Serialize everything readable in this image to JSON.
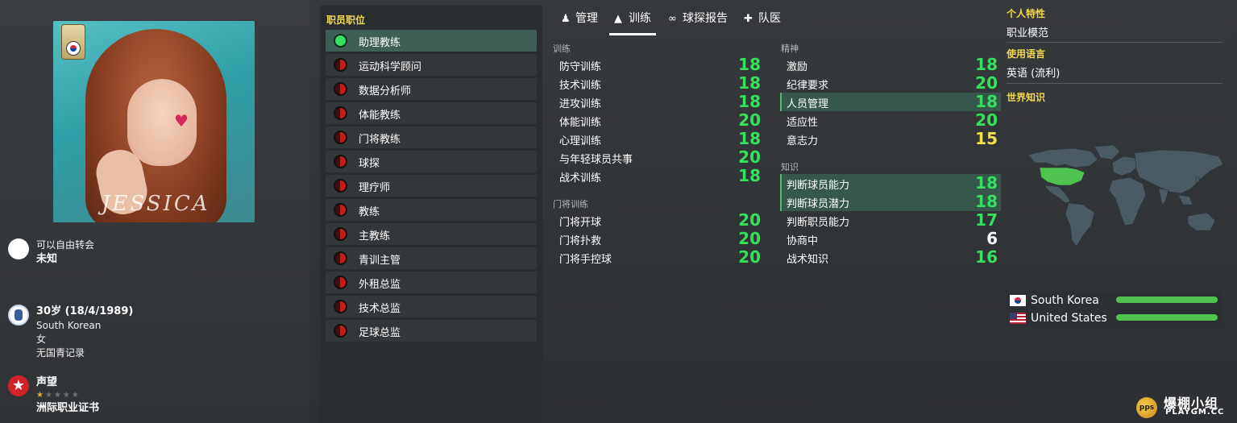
{
  "profile": {
    "transfer_status": "可以自由转会",
    "transfer_value": "未知",
    "age_line": "30岁 (18/4/1989)",
    "nationality": "South Korean",
    "gender": "女",
    "youth_record": "无国青记录",
    "reputation_label": "声望",
    "reputation_stars": 0.5,
    "license": "洲际职业证书",
    "portrait_signature": "JESSICA"
  },
  "roles": {
    "title": "职员职位",
    "items": [
      {
        "label": "助理教练",
        "selected": true
      },
      {
        "label": "运动科学顾问",
        "selected": false
      },
      {
        "label": "数据分析师",
        "selected": false
      },
      {
        "label": "体能教练",
        "selected": false
      },
      {
        "label": "门将教练",
        "selected": false
      },
      {
        "label": "球探",
        "selected": false
      },
      {
        "label": "理疗师",
        "selected": false
      },
      {
        "label": "教练",
        "selected": false
      },
      {
        "label": "主教练",
        "selected": false
      },
      {
        "label": "青训主管",
        "selected": false
      },
      {
        "label": "外租总监",
        "selected": false
      },
      {
        "label": "技术总监",
        "selected": false
      },
      {
        "label": "足球总监",
        "selected": false
      }
    ]
  },
  "tabs": [
    {
      "label": "管理",
      "icon": "manager-icon"
    },
    {
      "label": "训练",
      "icon": "cone-icon",
      "active": true
    },
    {
      "label": "球探报告",
      "icon": "binoculars-icon"
    },
    {
      "label": "队医",
      "icon": "medical-kit-icon"
    }
  ],
  "training": {
    "title": "训练",
    "rows": [
      {
        "name": "防守训练",
        "value": "18"
      },
      {
        "name": "技术训练",
        "value": "18"
      },
      {
        "name": "进攻训练",
        "value": "18"
      },
      {
        "name": "体能训练",
        "value": "20"
      },
      {
        "name": "心理训练",
        "value": "18"
      },
      {
        "name": "与年轻球员共事",
        "value": "20"
      },
      {
        "name": "战术训练",
        "value": "18"
      }
    ]
  },
  "goalkeeping": {
    "title": "门将训练",
    "rows": [
      {
        "name": "门将开球",
        "value": "20"
      },
      {
        "name": "门将扑救",
        "value": "20"
      },
      {
        "name": "门将手控球",
        "value": "20"
      }
    ]
  },
  "mental": {
    "title": "精神",
    "rows": [
      {
        "name": "激励",
        "value": "18"
      },
      {
        "name": "纪律要求",
        "value": "20"
      },
      {
        "name": "人员管理",
        "value": "18",
        "highlight": true
      },
      {
        "name": "适应性",
        "value": "20"
      },
      {
        "name": "意志力",
        "value": "15"
      }
    ]
  },
  "knowledge": {
    "title": "知识",
    "rows": [
      {
        "name": "判断球员能力",
        "value": "18",
        "highlight": true
      },
      {
        "name": "判断球员潜力",
        "value": "18",
        "highlight": true
      },
      {
        "name": "判断职员能力",
        "value": "17"
      },
      {
        "name": "协商中",
        "value": "6"
      },
      {
        "name": "战术知识",
        "value": "16"
      }
    ]
  },
  "right_panel": {
    "traits_title": "个人特性",
    "traits_value": "职业模范",
    "languages_title": "使用语言",
    "languages_value": "英语 (流利)",
    "world_title": "世界知识",
    "world_highlight_country": "United States",
    "countries": [
      {
        "name": "South Korea",
        "flag": "south-korea-flag-icon",
        "level": 1.0
      },
      {
        "name": "United States",
        "flag": "usa-flag-icon",
        "level": 1.0
      }
    ]
  },
  "colors": {
    "value_high": "#35e05c",
    "value_mid": "#f2e047",
    "value_low": "#ffffff",
    "section_title": "#f2d84a",
    "highlight_row": "#37574c",
    "bar": "#4fc24f"
  },
  "watermark": {
    "cn": "爆棚小组",
    "en": "PLAYGM.CC",
    "logo": "pps"
  }
}
